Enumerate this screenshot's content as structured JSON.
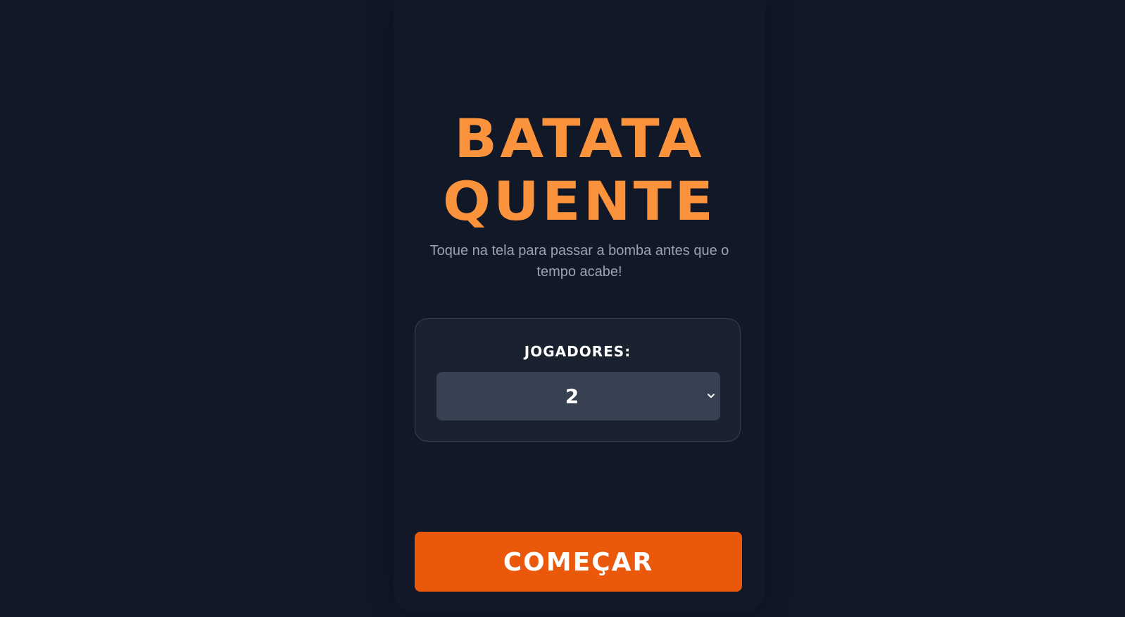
{
  "title": {
    "line1": "BATATA",
    "line2": "QUENTE"
  },
  "subtitle": "Toque na tela para passar a bomba antes que o tempo acabe!",
  "players": {
    "label": "JOGADORES:",
    "selected_value": "2"
  },
  "start_button_label": "COMEÇAR",
  "icons": {
    "select_arrow": "chevron-down-icon"
  },
  "colors": {
    "background": "#111827",
    "title": "#fb923c",
    "panel": "#1a2230",
    "select": "#374151",
    "button": "#ea580c"
  }
}
